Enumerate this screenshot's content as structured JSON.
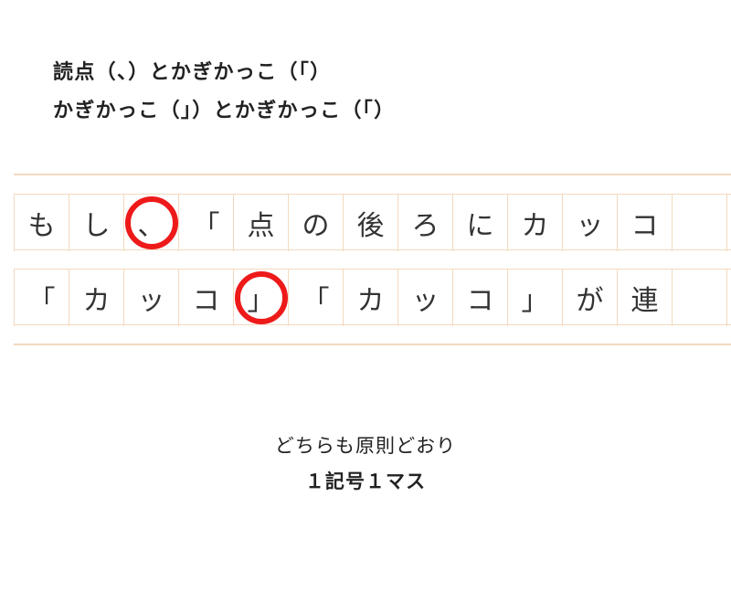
{
  "heading": {
    "line1": "読点（、）とかぎかっこ（「）",
    "line2": "かぎかっこ（」）とかぎかっこ（「）"
  },
  "grid": {
    "rows": [
      {
        "cells": [
          "も",
          "し",
          "、",
          "「",
          "点",
          "の",
          "後",
          "ろ",
          "に",
          "カ",
          "ッ",
          "コ"
        ],
        "circle_index": 2
      },
      {
        "cells": [
          "「",
          "カ",
          "ッ",
          "コ",
          "」",
          "「",
          "カ",
          "ッ",
          "コ",
          "」",
          "が",
          "連"
        ],
        "circle_index": 4
      }
    ],
    "num_cols": 14
  },
  "footer": {
    "line1": "どちらも原則どおり",
    "line2": "１記号１マス"
  },
  "colors": {
    "grid_line": "#f3d9bf",
    "circle": "#ee1a1a",
    "text": "#222"
  }
}
